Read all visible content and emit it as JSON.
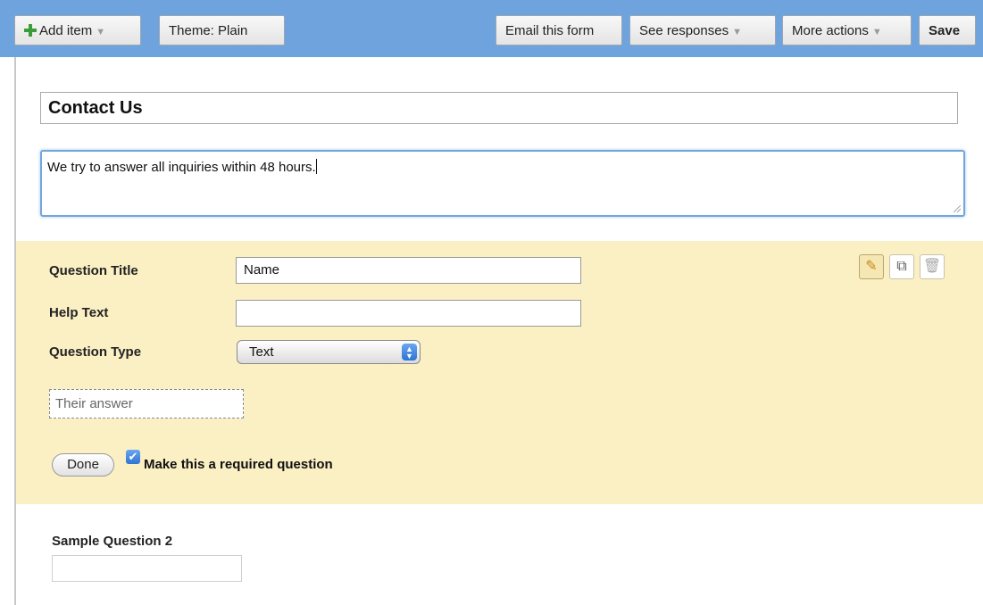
{
  "toolbar": {
    "add_item": "Add item",
    "theme": "Theme:  Plain",
    "email": "Email this form",
    "see_responses": "See responses",
    "more_actions": "More actions",
    "save": "Save",
    "caret": "▼"
  },
  "form": {
    "title": "Contact Us",
    "description": "We try to answer all inquiries within 48 hours."
  },
  "editor": {
    "title_label": "Question Title",
    "title_value": "Name",
    "help_label": "Help Text",
    "help_value": "",
    "type_label": "Question Type",
    "type_value": "Text",
    "answer_placeholder": "Their answer",
    "done_label": "Done",
    "required_label": "Make this a required question",
    "required_checked": true,
    "icons": [
      "pencil-icon",
      "duplicate-icon",
      "trash-icon"
    ]
  },
  "question2": {
    "title": "Sample Question 2"
  },
  "colors": {
    "toolbar_bg": "#6fa3de",
    "editor_bg": "#fbefc4",
    "focus_border": "#73a6da"
  }
}
